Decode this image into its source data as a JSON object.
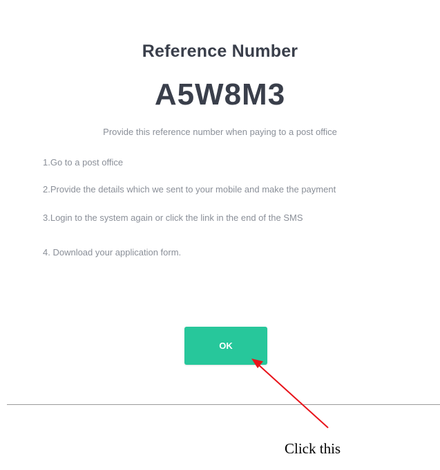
{
  "dialog": {
    "title": "Reference Number",
    "reference_code": "A5W8M3",
    "subtitle": "Provide this reference number when paying to a post office",
    "steps": [
      "1.Go to a post office",
      "2.Provide the details which we sent to your mobile and make the payment",
      "3.Login to the system again or click the link in the end of the SMS",
      "4. Download your application form."
    ],
    "ok_label": "OK"
  },
  "annotation": {
    "text": "Click this",
    "arrow_color": "#e8141b"
  },
  "colors": {
    "accent": "#27c79b",
    "heading": "#3a3f4b",
    "muted_text": "#8a8f98"
  }
}
